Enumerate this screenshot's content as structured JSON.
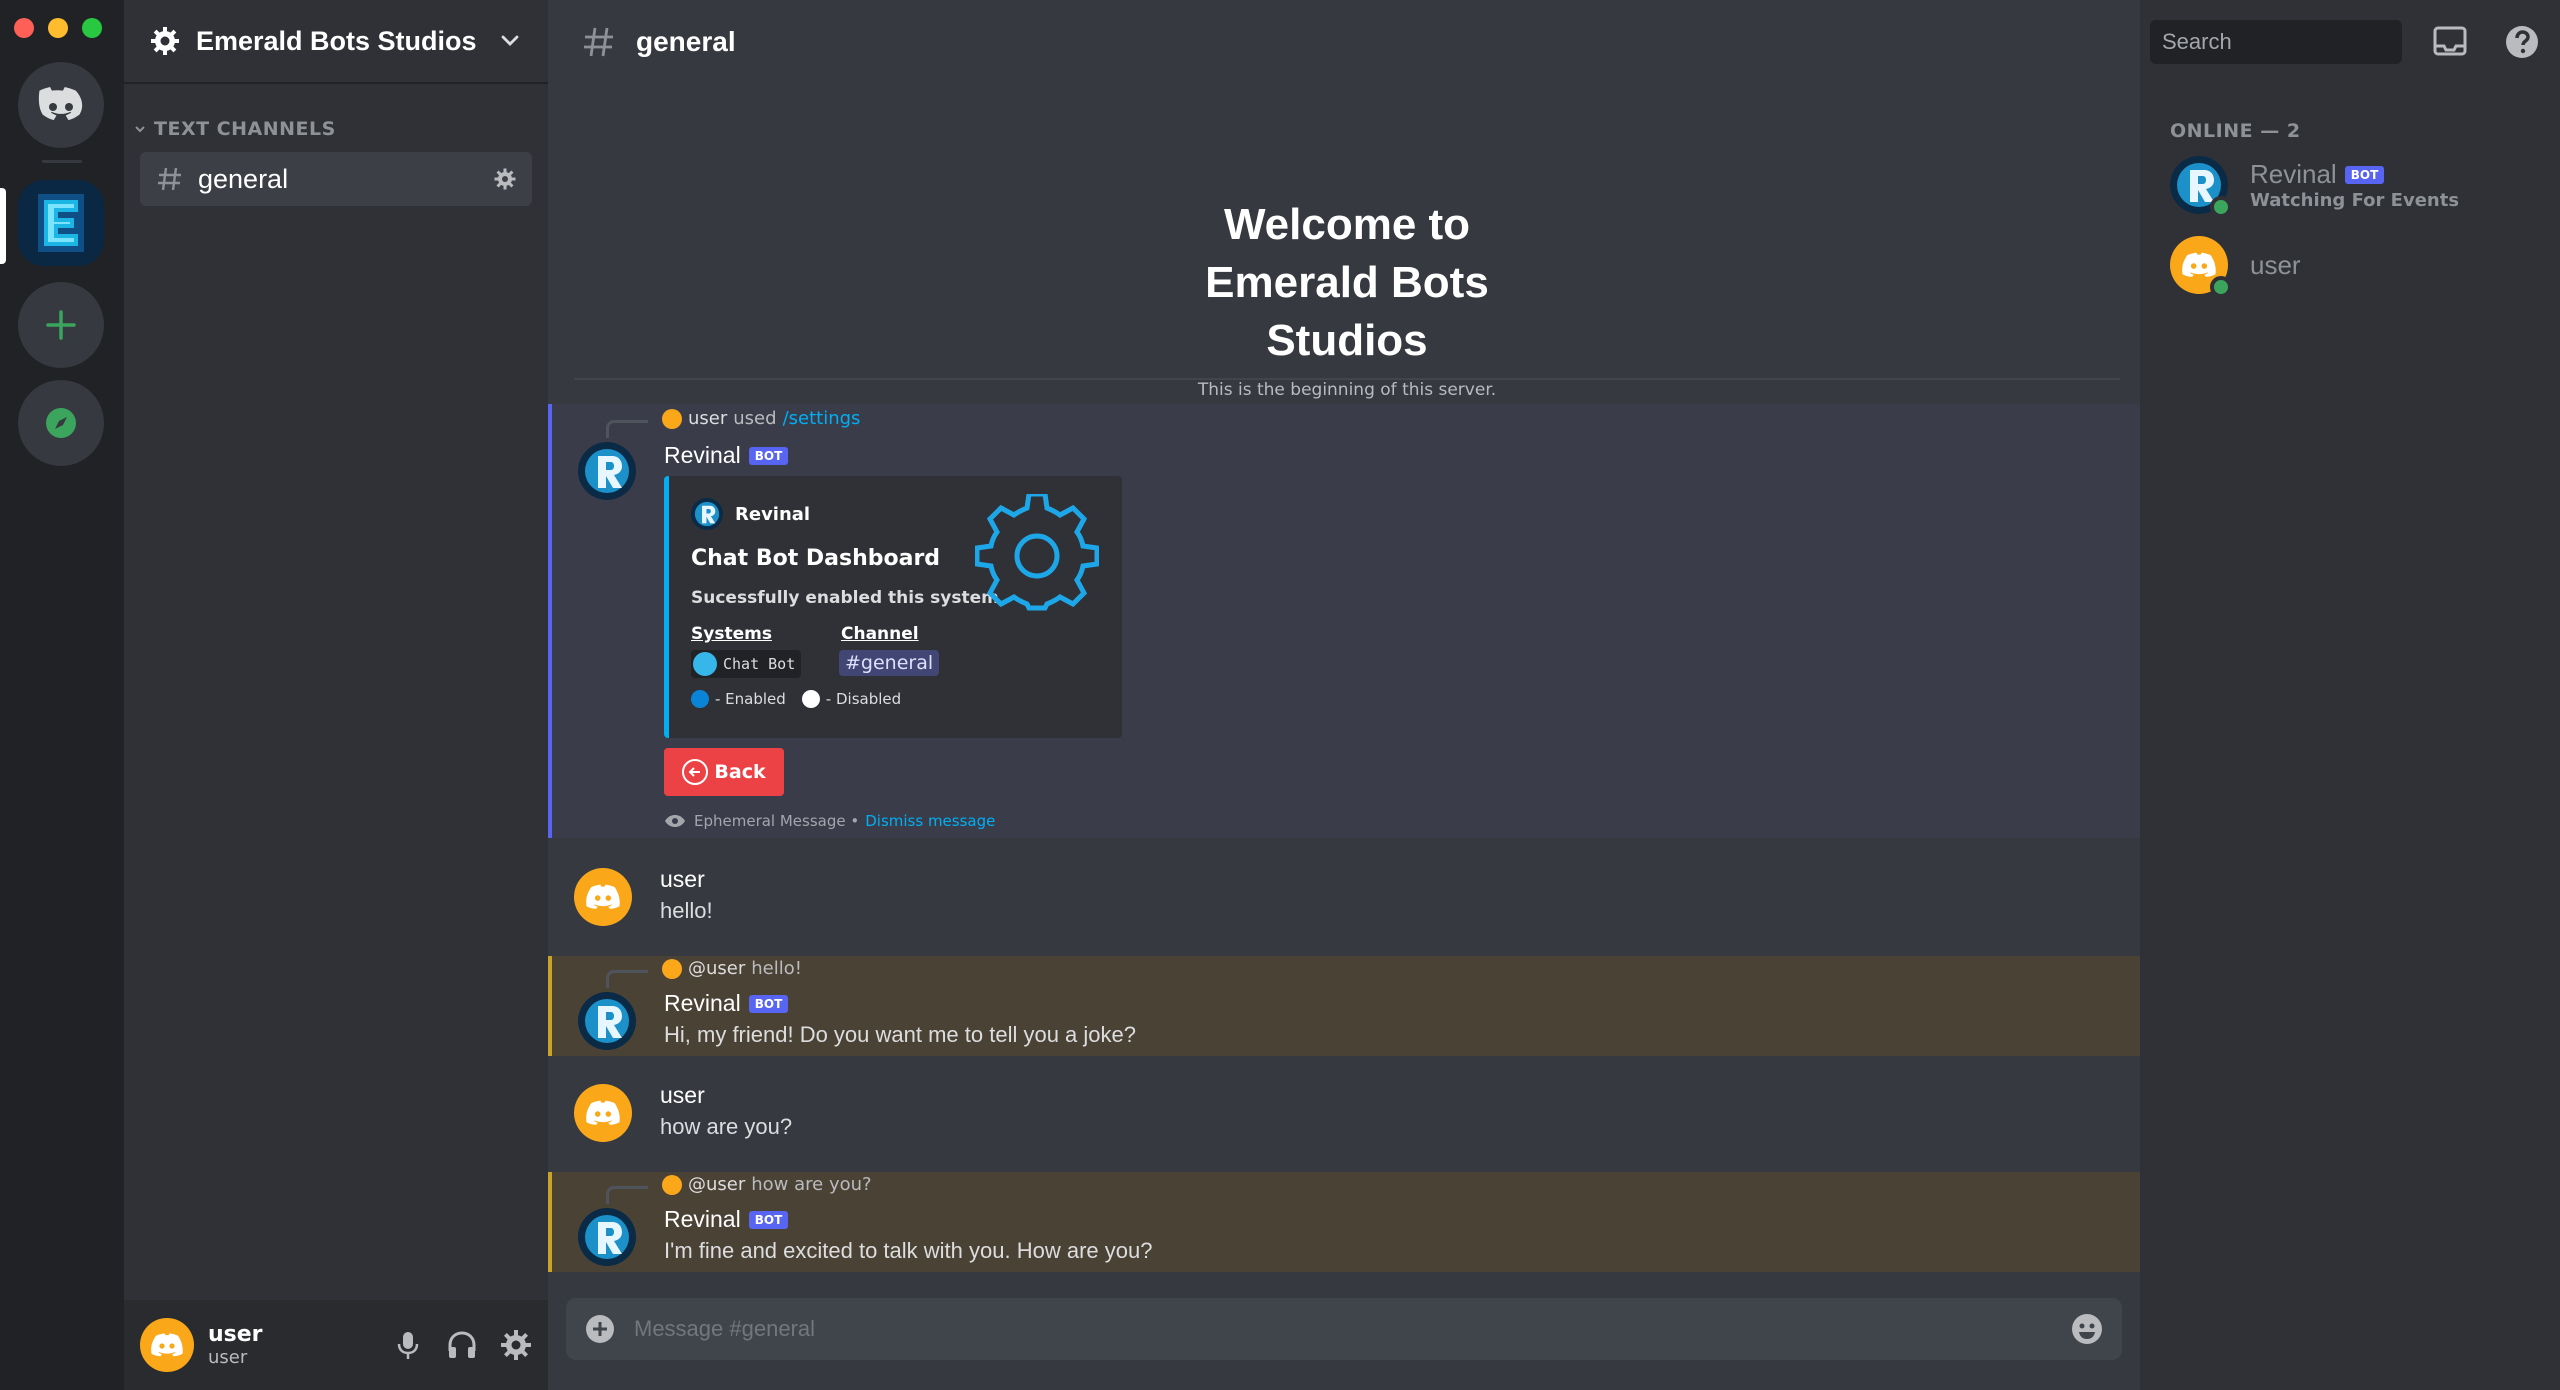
{
  "server": {
    "name": "Emerald Bots Studios"
  },
  "sidebar": {
    "category": "TEXT CHANNELS",
    "channels": [
      {
        "name": "general"
      }
    ]
  },
  "user_panel": {
    "name": "user",
    "tag": "user"
  },
  "channel_header": {
    "name": "general"
  },
  "welcome": {
    "title": "Welcome to Emerald Bots Studios",
    "subtitle": "This is the beginning of this server."
  },
  "messages": [
    {
      "reply": {
        "who": "user",
        "text": "used",
        "command": "/settings"
      },
      "author": "Revinal",
      "badge": "BOT",
      "embed": {
        "author": "Revinal",
        "title": "Chat Bot Dashboard",
        "description": "Sucessfully enabled this system",
        "field1_name": "Systems",
        "field1_value": "Chat Bot",
        "field2_name": "Channel",
        "field2_value": "#general",
        "legend_enabled": "- Enabled",
        "legend_disabled": "- Disabled"
      },
      "button": "Back",
      "ephemeral_note": "Ephemeral Message •",
      "dismiss": "Dismiss message"
    },
    {
      "author": "user",
      "text": "hello!"
    },
    {
      "reply": {
        "who": "@user",
        "text": "hello!"
      },
      "author": "Revinal",
      "badge": "BOT",
      "text": "Hi, my friend! Do you want me to tell you a joke?"
    },
    {
      "author": "user",
      "text": "how are you?"
    },
    {
      "reply": {
        "who": "@user",
        "text": "how are you?"
      },
      "author": "Revinal",
      "badge": "BOT",
      "text": "I'm fine and excited to talk with you. How are you?"
    }
  ],
  "composer": {
    "placeholder": "Message #general"
  },
  "search": {
    "placeholder": "Search"
  },
  "members": {
    "header": "ONLINE — 2",
    "list": [
      {
        "name": "Revinal",
        "badge": "BOT",
        "activity": "Watching For Events"
      },
      {
        "name": "user"
      }
    ]
  },
  "colors": {
    "blurple": "#5865f2",
    "online": "#3ba55d",
    "danger": "#ed4245",
    "link": "#00aff4",
    "user_avatar": "#faa81a"
  }
}
